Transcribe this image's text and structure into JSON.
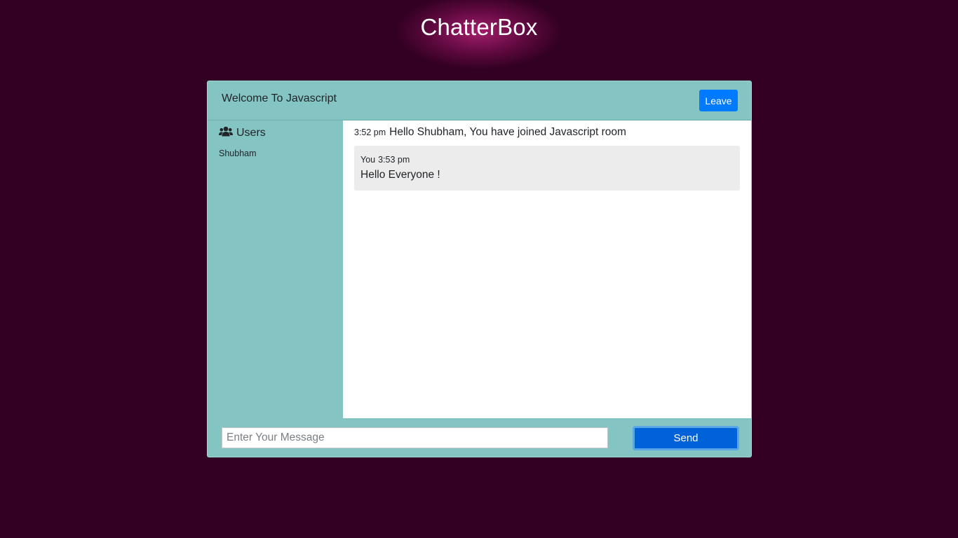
{
  "app": {
    "title": "ChatterBox"
  },
  "header": {
    "room_title": "Welcome To Javascript",
    "leave_label": "Leave"
  },
  "sidebar": {
    "heading": "Users",
    "heading_icon": "users-icon",
    "users": [
      "Shubham"
    ]
  },
  "messages": {
    "system": {
      "time": "3:52 pm",
      "text": "Hello Shubham, You have joined Javascript room"
    },
    "items": [
      {
        "author": "You",
        "time": "3:53 pm",
        "text": "Hello Everyone !"
      }
    ]
  },
  "composer": {
    "placeholder": "Enter Your Message",
    "value": "",
    "send_label": "Send"
  },
  "colors": {
    "background": "#320022",
    "panel": "#84c4c3",
    "leave_button": "#007bff",
    "send_button": "#0062d9",
    "bubble": "#ececec"
  }
}
